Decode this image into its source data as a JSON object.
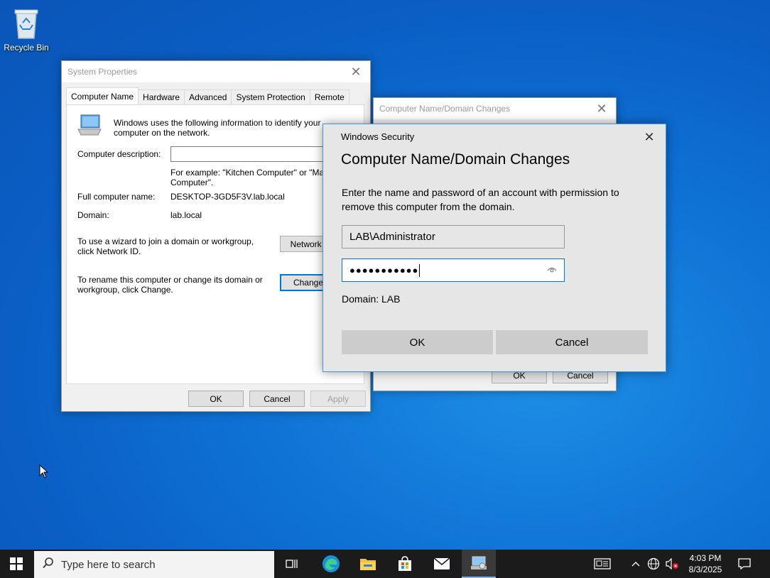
{
  "desktop": {
    "recycle_bin_label": "Recycle Bin"
  },
  "system_properties": {
    "title": "System Properties",
    "tabs": [
      "Computer Name",
      "Hardware",
      "Advanced",
      "System Protection",
      "Remote"
    ],
    "intro": "Windows uses the following information to identify your computer on the network.",
    "description_label": "Computer description:",
    "example": "For example: \"Kitchen Computer\" or \"Mary",
    "example2": "Computer\".",
    "full_name_label": "Full computer name:",
    "full_name_value": "DESKTOP-3GD5F3V.lab.local",
    "domain_label": "Domain:",
    "domain_value": "lab.local",
    "network_id_text": "To use a wizard to join a domain or workgroup, click Network ID.",
    "network_id_button": "Network I",
    "rename_text": "To rename this computer or change its domain or workgroup, click Change.",
    "change_button": "Change",
    "ok": "OK",
    "cancel": "Cancel",
    "apply": "Apply"
  },
  "name_domain_changes": {
    "title": "Computer Name/Domain Changes",
    "ok": "OK",
    "cancel": "Cancel"
  },
  "windows_security": {
    "title": "Windows Security",
    "heading": "Computer Name/Domain Changes",
    "message": "Enter the name and password of an account with permission to remove this computer from the domain.",
    "username_value": "LAB\\Administrator",
    "password_value": "●●●●●●●●●●●",
    "domain_text": "Domain: LAB",
    "ok": "OK",
    "cancel": "Cancel"
  },
  "taskbar": {
    "search_placeholder": "Type here to search",
    "time": "4:03 PM",
    "date": "8/3/2025"
  }
}
